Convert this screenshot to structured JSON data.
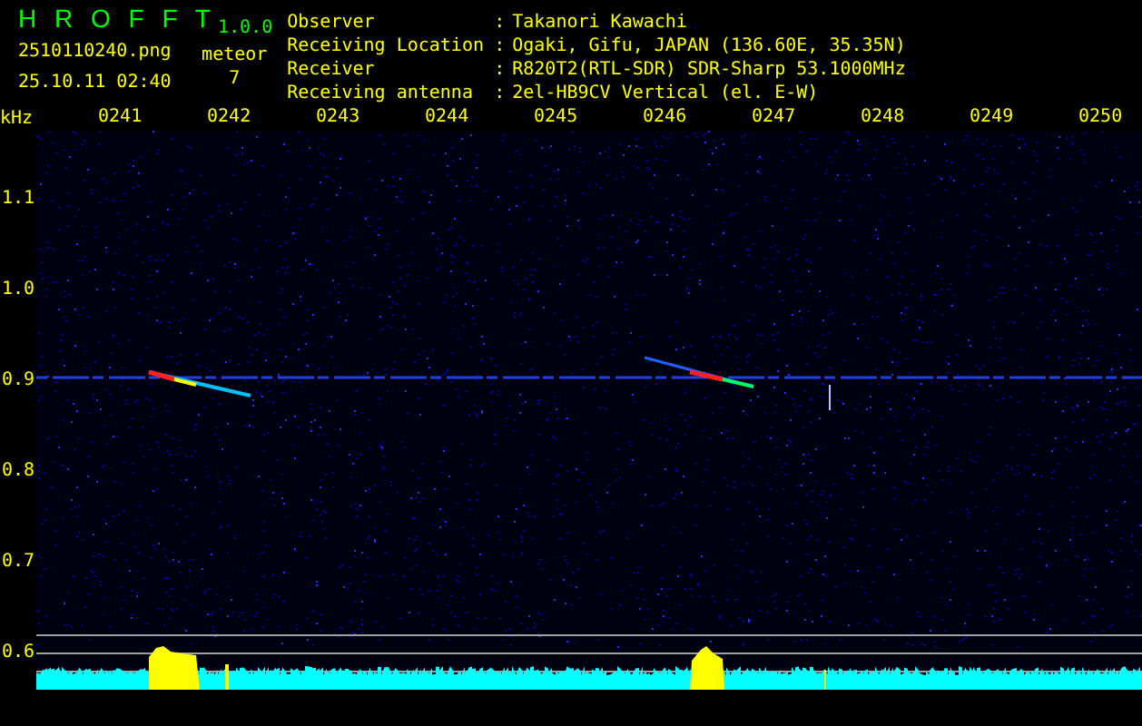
{
  "app": {
    "title": "H R O F F T",
    "version": "1.0.0"
  },
  "file": {
    "filename": "2510110240.png",
    "timestamp": "25.10.11 02:40"
  },
  "meteor": {
    "label": "meteor",
    "count": "7"
  },
  "info": [
    {
      "label": "Observer",
      "separator": ":",
      "value": "Takanori Kawachi"
    },
    {
      "label": "Receiving Location",
      "separator": ":",
      "value": "Ogaki, Gifu, JAPAN (136.60E, 35.35N)"
    },
    {
      "label": "Receiver",
      "separator": ":",
      "value": "R820T2(RTL-SDR) SDR-Sharp 53.1000MHz"
    },
    {
      "label": "Receiving antenna",
      "separator": ":",
      "value": "2el-HB9CV Vertical (el. E-W)"
    }
  ],
  "axis": {
    "unit": "kHz",
    "time_labels": [
      "0241",
      "0242",
      "0243",
      "0244",
      "0245",
      "0246",
      "0247",
      "0248",
      "0249",
      "0250"
    ],
    "freq_labels": [
      "1.1",
      "1.0",
      "0.9",
      "0.8",
      "0.7",
      "0.6"
    ]
  }
}
